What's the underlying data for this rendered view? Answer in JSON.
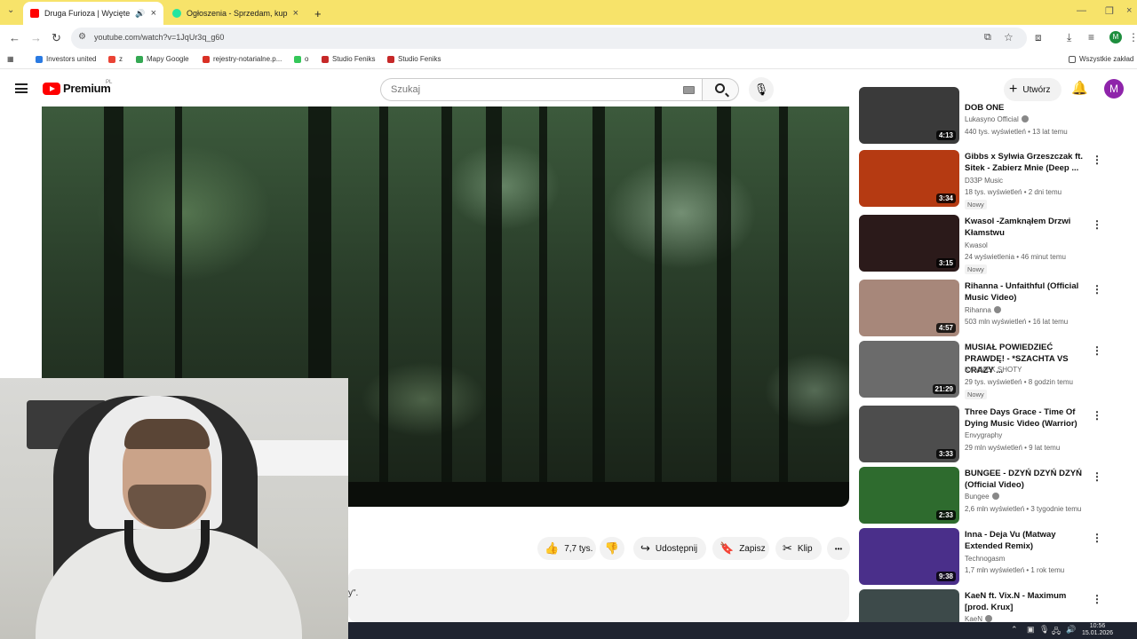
{
  "browser": {
    "tabs": [
      {
        "title": "Druga Furioza | Wycięte sce",
        "active": true,
        "favicon_color": "#ff0000"
      },
      {
        "title": "Ogłoszenia - Sprzedam, kupię ",
        "active": false,
        "favicon_color": "#23e5a0"
      }
    ],
    "new_tab_label": "+",
    "url": "youtube.com/watch?v=1JqUr3q_g60",
    "avatar_letter": "M"
  },
  "bookmarks": [
    {
      "label": "Investors united",
      "color": "#2a7ae2"
    },
    {
      "label": "z",
      "color": "#ea4335"
    },
    {
      "label": "Mapy Google",
      "color": "#34a853"
    },
    {
      "label": "rejestry-notarialne.p...",
      "color": "#d93025"
    },
    {
      "label": "o",
      "color": "#34c759"
    },
    {
      "label": "Studio Feniks",
      "color": "#c62828"
    },
    {
      "label": "Studio Feniks",
      "color": "#c62828"
    },
    {
      "label": "Wszystkie zakład",
      "color": "#555555"
    }
  ],
  "youtube": {
    "brand": "Premium",
    "region": "PL",
    "search_placeholder": "Szukaj",
    "create_label": "Utwórz",
    "avatar_letter": "M",
    "accent": "#ff0000"
  },
  "video_actions": {
    "likes": "7,7 tys.",
    "share": "Udostępnij",
    "save": "Zapisz",
    "clip": "Klip",
    "more": "•••"
  },
  "description_fragment": "y\".",
  "recommendations": [
    {
      "title": "DOB ONE",
      "channel": "Lukasyno Official",
      "verified": true,
      "meta": "440 tys. wyświetleń • 13 lat temu",
      "duration": "4:13",
      "badge": "",
      "thumb": "#3a3a3a"
    },
    {
      "title": "Gibbs x Sylwia Grzeszczak ft. Sitek - Zabierz Mnie (Deep ...",
      "channel": "D33P Music",
      "verified": false,
      "meta": "18 tys. wyświetleń • 2 dni temu",
      "duration": "3:34",
      "badge": "Nowy",
      "thumb": "#b53a12"
    },
    {
      "title": "Kwasol -Zamknąłem Drzwi Kłamstwu",
      "channel": "Kwasol",
      "verified": false,
      "meta": "24 wyświetlenia • 46 minut temu",
      "duration": "3:15",
      "badge": "Nowy",
      "thumb": "#2b1a1a"
    },
    {
      "title": "Rihanna - Unfaithful (Official Music Video)",
      "channel": "Rihanna",
      "verified": true,
      "meta": "503 mln wyświetleń • 16 lat temu",
      "duration": "4:57",
      "badge": "",
      "thumb": "#a7877a"
    },
    {
      "title": "MUSIAŁ POWIEDZIEĆ PRAWDĘ! - *SZACHTA VS CRAZY ...",
      "channel": "KAMMEK SHOTY",
      "verified": false,
      "meta": "29 tys. wyświetleń • 8 godzin temu",
      "duration": "21:29",
      "badge": "Nowy",
      "thumb": "#6b6b6b"
    },
    {
      "title": "Three Days Grace - Time Of Dying Music Video (Warrior)",
      "channel": "Envygraphy",
      "verified": false,
      "meta": "29 mln wyświetleń • 9 lat temu",
      "duration": "3:33",
      "badge": "",
      "thumb": "#4d4d4d"
    },
    {
      "title": "BUNGEE - DZYŃ DZYŃ DZYŃ (Official Video)",
      "channel": "Bungee",
      "verified": true,
      "meta": "2,6 mln wyświetleń • 3 tygodnie temu",
      "duration": "2:33",
      "badge": "",
      "thumb": "#2e6b2e"
    },
    {
      "title": "Inna - Deja Vu (Matway Extended Remix)",
      "channel": "Technogasm",
      "verified": false,
      "meta": "1,7 mln wyświetleń • 1 rok temu",
      "duration": "9:38",
      "badge": "",
      "thumb": "#4a2f8a"
    },
    {
      "title": "KaeN ft. Vix.N - Maximum [prod. Krux]",
      "channel": "KaeN",
      "verified": true,
      "meta": "",
      "duration": "",
      "badge": "",
      "thumb": "#3d4a4a"
    }
  ],
  "taskbar": {
    "time": "10:56",
    "date": "15.01.2026"
  }
}
